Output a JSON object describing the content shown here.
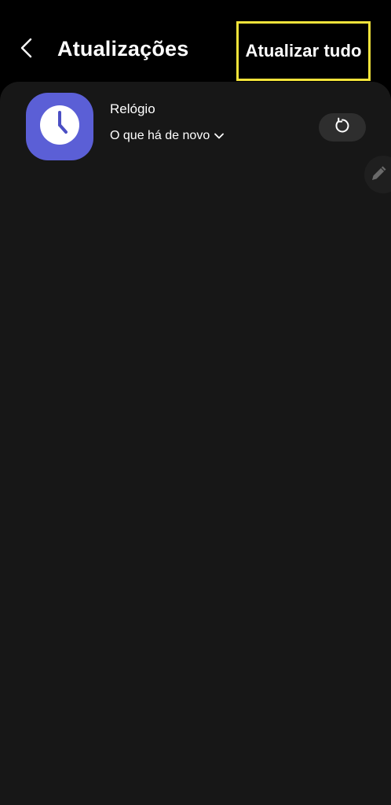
{
  "header": {
    "back_icon": "chevron-left-icon",
    "title": "Atualizações",
    "update_all_label": "Atualizar tudo"
  },
  "updates": [
    {
      "app_name": "Relógio",
      "app_icon": "clock-icon",
      "whats_new_label": "O que há de novo",
      "whats_new_icon": "chevron-down-icon",
      "action_icon": "refresh-icon"
    }
  ],
  "floating_action": {
    "icon": "pencil-icon"
  },
  "colors": {
    "background": "#000000",
    "panel": "#171717",
    "app_icon_bg": "#5b5fd6",
    "highlight_border": "#f2e33a",
    "button_bg": "#2e2e2e"
  }
}
